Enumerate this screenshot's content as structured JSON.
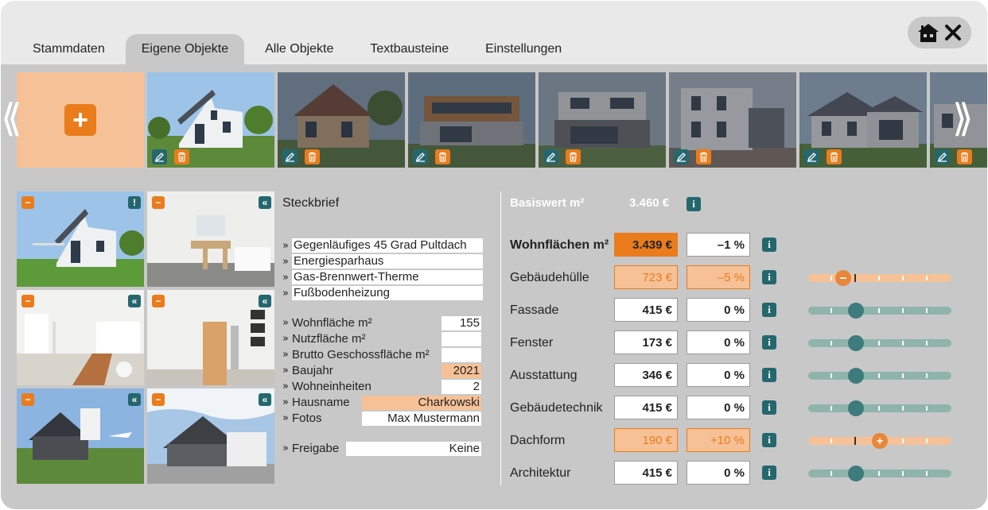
{
  "tabs": [
    {
      "label": "Stammdaten"
    },
    {
      "label": "Eigene Objekte"
    },
    {
      "label": "Alle Objekte"
    },
    {
      "label": "Textbausteine"
    },
    {
      "label": "Einstellungen"
    }
  ],
  "active_tab": "Eigene Objekte",
  "window_controls": {
    "home_icon": "home-icon",
    "close_icon": "close-icon"
  },
  "strip": {
    "add_icon": "plus-icon",
    "prev_icon": "chevron-double-left-icon",
    "next_icon": "chevron-double-right-icon",
    "thumb_actions": [
      "edit-icon",
      "trash-icon"
    ]
  },
  "gallery_markers": [
    "−",
    "!",
    "«"
  ],
  "steckbrief": {
    "title": "Steckbrief",
    "features": [
      "Gegenläufiges 45 Grad Pultdach",
      "Energiesparhaus",
      "Gas-Brennwert-Therme",
      "Fußbodenheizung"
    ],
    "fields": [
      {
        "label": "Wohnfläche m²",
        "value": "155"
      },
      {
        "label": "Nutzfläche m²",
        "value": ""
      },
      {
        "label": "Brutto Geschossfläche m²",
        "value": ""
      },
      {
        "label": "Baujahr",
        "value": "2021"
      },
      {
        "label": "Wohneinheiten",
        "value": "2"
      },
      {
        "label": "Hausname",
        "value": "Charkowski"
      },
      {
        "label": "Fotos",
        "value": "Max Mustermann"
      }
    ],
    "freigabe": {
      "label": "Freigabe",
      "value": "Keine"
    }
  },
  "valuation": {
    "basis_label": "Basiswert m²",
    "basis_value": "3.460 €",
    "info_label": "i",
    "rows": [
      {
        "label": "Wohnflächen m²",
        "value": "3.439 €",
        "percent": "–1 %"
      },
      {
        "label": "Gebäudehülle",
        "value": "723 €",
        "percent": "–5 %",
        "slider_level": -5
      },
      {
        "label": "Fassade",
        "value": "415 €",
        "percent": "0 %",
        "slider_level": 0
      },
      {
        "label": "Fenster",
        "value": "173 €",
        "percent": "0 %",
        "slider_level": 0
      },
      {
        "label": "Ausstattung",
        "value": "346 €",
        "percent": "0 %",
        "slider_level": 0
      },
      {
        "label": "Gebäudetechnik",
        "value": "415 €",
        "percent": "0 %",
        "slider_level": 0
      },
      {
        "label": "Dachform",
        "value": "190 €",
        "percent": "+10 %",
        "slider_level": 10
      },
      {
        "label": "Architektur",
        "value": "415 €",
        "percent": "0 %",
        "slider_level": 0
      }
    ]
  },
  "colors": {
    "accent": "#ea7c1c",
    "accent_light": "#f6c196",
    "teal": "#24676e",
    "panel": "#c8c8c8"
  }
}
